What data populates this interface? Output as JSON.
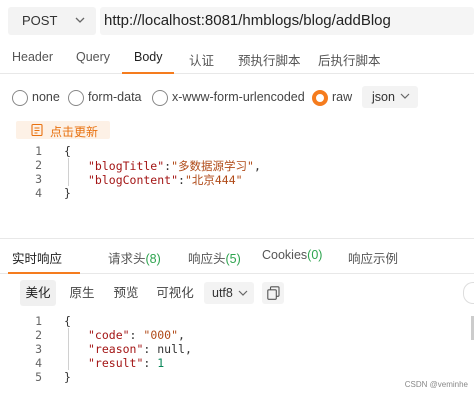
{
  "request": {
    "method": "POST",
    "url": "http://localhost:8081/hmblogs/blog/addBlog"
  },
  "request_tabs": [
    "Header",
    "Query",
    "Body",
    "认证",
    "预执行脚本",
    "后执行脚本"
  ],
  "body_types": [
    "none",
    "form-data",
    "x-www-form-urlencoded",
    "raw"
  ],
  "body_format": "json",
  "beautify_label": "点击更新",
  "request_body": {
    "line_numbers": [
      "1",
      "2",
      "3",
      "4"
    ],
    "open_brace": "{",
    "close_brace": "}",
    "line2_key": "\"blogTitle\"",
    "line2_value": "\"多数据源学习\"",
    "line3_key": "\"blogContent\"",
    "line3_value": "\"北京444\""
  },
  "response_tabs": {
    "realtime": "实时响应",
    "req_header_label": "请求头",
    "req_header_count": "(8)",
    "resp_header_label": "响应头",
    "resp_header_count": "(5)",
    "cookies_label": "Cookies",
    "cookies_count": "(0)",
    "example": "响应示例"
  },
  "view_modes": [
    "美化",
    "原生",
    "预览",
    "可视化"
  ],
  "encoding": "utf8",
  "response_body": {
    "line_numbers": [
      "1",
      "2",
      "3",
      "4",
      "5"
    ],
    "open_brace": "{",
    "close_brace": "}",
    "code_key": "\"code\"",
    "code_value": "\"000\"",
    "reason_key": "\"reason\"",
    "reason_value": "null",
    "result_key": "\"result\"",
    "result_value": "1"
  },
  "watermark": "CSDN @veminhe",
  "colors": {
    "accent": "#f57c1e",
    "count": "#2ea44f"
  },
  "icons": [
    "chevron-down-icon",
    "beautify-icon",
    "copy-icon"
  ]
}
